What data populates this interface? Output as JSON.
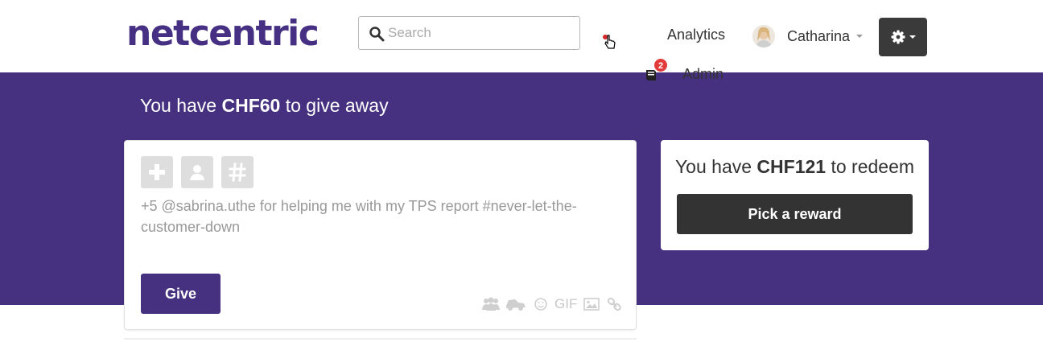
{
  "header": {
    "logo": "netcentric",
    "search": {
      "placeholder": "Search",
      "value": ""
    },
    "nav": {
      "analytics": "Analytics",
      "admin": "Admin",
      "admin_badge": "2"
    },
    "user": {
      "name": "Catharina"
    },
    "icons": {
      "search": "search-icon",
      "settings": "gear-icon",
      "admin": "book-icon",
      "pointer": "hand-pointer-icon"
    }
  },
  "hero": {
    "give_prefix": "You have ",
    "give_amount": "CHF60",
    "give_suffix": " to give away"
  },
  "compose": {
    "tools": [
      "plus-icon",
      "user-icon",
      "hash-icon"
    ],
    "placeholder_text": "+5 @sabrina.uthe for helping me with my TPS report #never-let-the-customer-down",
    "give_label": "Give",
    "attachments": [
      "group-icon",
      "car-icon",
      "smile-icon",
      "GIF",
      "image-icon",
      "link-icon"
    ]
  },
  "redeem": {
    "prefix": "You have ",
    "amount": "CHF121",
    "suffix": " to redeem",
    "button_label": "Pick a reward"
  },
  "colors": {
    "brand": "#45317f",
    "dark_button": "#333333",
    "badge": "#e23b3b"
  }
}
